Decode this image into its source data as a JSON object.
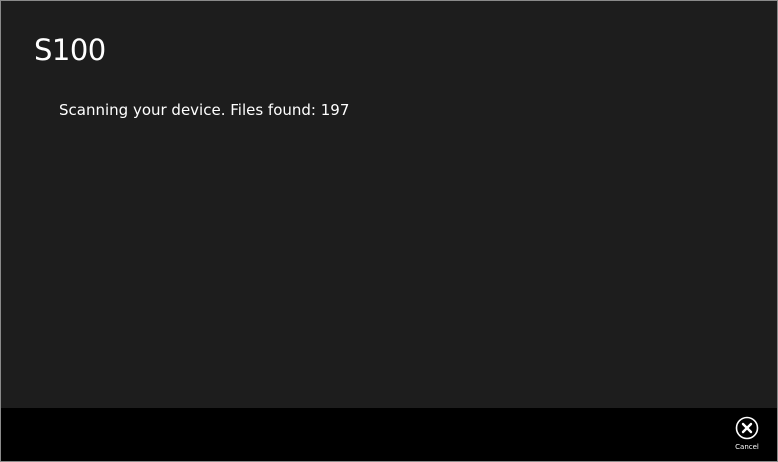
{
  "app": {
    "title": "S100"
  },
  "main": {
    "status_text": "Scanning your device. Files found: 197"
  },
  "appbar": {
    "cancel_label": "Cancel",
    "cancel_icon": "close-circle-icon"
  },
  "colors": {
    "background": "#1d1d1d",
    "appbar": "#000000",
    "text": "#ffffff"
  }
}
